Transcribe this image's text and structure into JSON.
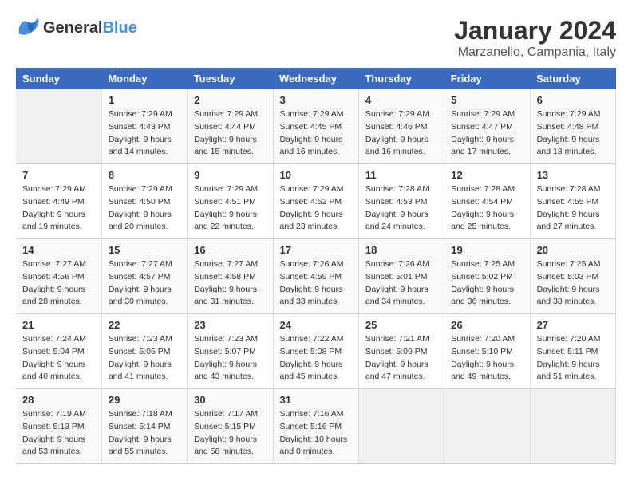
{
  "header": {
    "logo_general": "General",
    "logo_blue": "Blue",
    "title": "January 2024",
    "subtitle": "Marzanello, Campania, Italy"
  },
  "weekdays": [
    "Sunday",
    "Monday",
    "Tuesday",
    "Wednesday",
    "Thursday",
    "Friday",
    "Saturday"
  ],
  "weeks": [
    [
      {
        "day": "",
        "info": ""
      },
      {
        "day": "1",
        "info": "Sunrise: 7:29 AM\nSunset: 4:43 PM\nDaylight: 9 hours\nand 14 minutes."
      },
      {
        "day": "2",
        "info": "Sunrise: 7:29 AM\nSunset: 4:44 PM\nDaylight: 9 hours\nand 15 minutes."
      },
      {
        "day": "3",
        "info": "Sunrise: 7:29 AM\nSunset: 4:45 PM\nDaylight: 9 hours\nand 16 minutes."
      },
      {
        "day": "4",
        "info": "Sunrise: 7:29 AM\nSunset: 4:46 PM\nDaylight: 9 hours\nand 16 minutes."
      },
      {
        "day": "5",
        "info": "Sunrise: 7:29 AM\nSunset: 4:47 PM\nDaylight: 9 hours\nand 17 minutes."
      },
      {
        "day": "6",
        "info": "Sunrise: 7:29 AM\nSunset: 4:48 PM\nDaylight: 9 hours\nand 18 minutes."
      }
    ],
    [
      {
        "day": "7",
        "info": "Sunrise: 7:29 AM\nSunset: 4:49 PM\nDaylight: 9 hours\nand 19 minutes."
      },
      {
        "day": "8",
        "info": "Sunrise: 7:29 AM\nSunset: 4:50 PM\nDaylight: 9 hours\nand 20 minutes."
      },
      {
        "day": "9",
        "info": "Sunrise: 7:29 AM\nSunset: 4:51 PM\nDaylight: 9 hours\nand 22 minutes."
      },
      {
        "day": "10",
        "info": "Sunrise: 7:29 AM\nSunset: 4:52 PM\nDaylight: 9 hours\nand 23 minutes."
      },
      {
        "day": "11",
        "info": "Sunrise: 7:28 AM\nSunset: 4:53 PM\nDaylight: 9 hours\nand 24 minutes."
      },
      {
        "day": "12",
        "info": "Sunrise: 7:28 AM\nSunset: 4:54 PM\nDaylight: 9 hours\nand 25 minutes."
      },
      {
        "day": "13",
        "info": "Sunrise: 7:28 AM\nSunset: 4:55 PM\nDaylight: 9 hours\nand 27 minutes."
      }
    ],
    [
      {
        "day": "14",
        "info": "Sunrise: 7:27 AM\nSunset: 4:56 PM\nDaylight: 9 hours\nand 28 minutes."
      },
      {
        "day": "15",
        "info": "Sunrise: 7:27 AM\nSunset: 4:57 PM\nDaylight: 9 hours\nand 30 minutes."
      },
      {
        "day": "16",
        "info": "Sunrise: 7:27 AM\nSunset: 4:58 PM\nDaylight: 9 hours\nand 31 minutes."
      },
      {
        "day": "17",
        "info": "Sunrise: 7:26 AM\nSunset: 4:59 PM\nDaylight: 9 hours\nand 33 minutes."
      },
      {
        "day": "18",
        "info": "Sunrise: 7:26 AM\nSunset: 5:01 PM\nDaylight: 9 hours\nand 34 minutes."
      },
      {
        "day": "19",
        "info": "Sunrise: 7:25 AM\nSunset: 5:02 PM\nDaylight: 9 hours\nand 36 minutes."
      },
      {
        "day": "20",
        "info": "Sunrise: 7:25 AM\nSunset: 5:03 PM\nDaylight: 9 hours\nand 38 minutes."
      }
    ],
    [
      {
        "day": "21",
        "info": "Sunrise: 7:24 AM\nSunset: 5:04 PM\nDaylight: 9 hours\nand 40 minutes."
      },
      {
        "day": "22",
        "info": "Sunrise: 7:23 AM\nSunset: 5:05 PM\nDaylight: 9 hours\nand 41 minutes."
      },
      {
        "day": "23",
        "info": "Sunrise: 7:23 AM\nSunset: 5:07 PM\nDaylight: 9 hours\nand 43 minutes."
      },
      {
        "day": "24",
        "info": "Sunrise: 7:22 AM\nSunset: 5:08 PM\nDaylight: 9 hours\nand 45 minutes."
      },
      {
        "day": "25",
        "info": "Sunrise: 7:21 AM\nSunset: 5:09 PM\nDaylight: 9 hours\nand 47 minutes."
      },
      {
        "day": "26",
        "info": "Sunrise: 7:20 AM\nSunset: 5:10 PM\nDaylight: 9 hours\nand 49 minutes."
      },
      {
        "day": "27",
        "info": "Sunrise: 7:20 AM\nSunset: 5:11 PM\nDaylight: 9 hours\nand 51 minutes."
      }
    ],
    [
      {
        "day": "28",
        "info": "Sunrise: 7:19 AM\nSunset: 5:13 PM\nDaylight: 9 hours\nand 53 minutes."
      },
      {
        "day": "29",
        "info": "Sunrise: 7:18 AM\nSunset: 5:14 PM\nDaylight: 9 hours\nand 55 minutes."
      },
      {
        "day": "30",
        "info": "Sunrise: 7:17 AM\nSunset: 5:15 PM\nDaylight: 9 hours\nand 58 minutes."
      },
      {
        "day": "31",
        "info": "Sunrise: 7:16 AM\nSunset: 5:16 PM\nDaylight: 10 hours\nand 0 minutes."
      },
      {
        "day": "",
        "info": ""
      },
      {
        "day": "",
        "info": ""
      },
      {
        "day": "",
        "info": ""
      }
    ]
  ]
}
